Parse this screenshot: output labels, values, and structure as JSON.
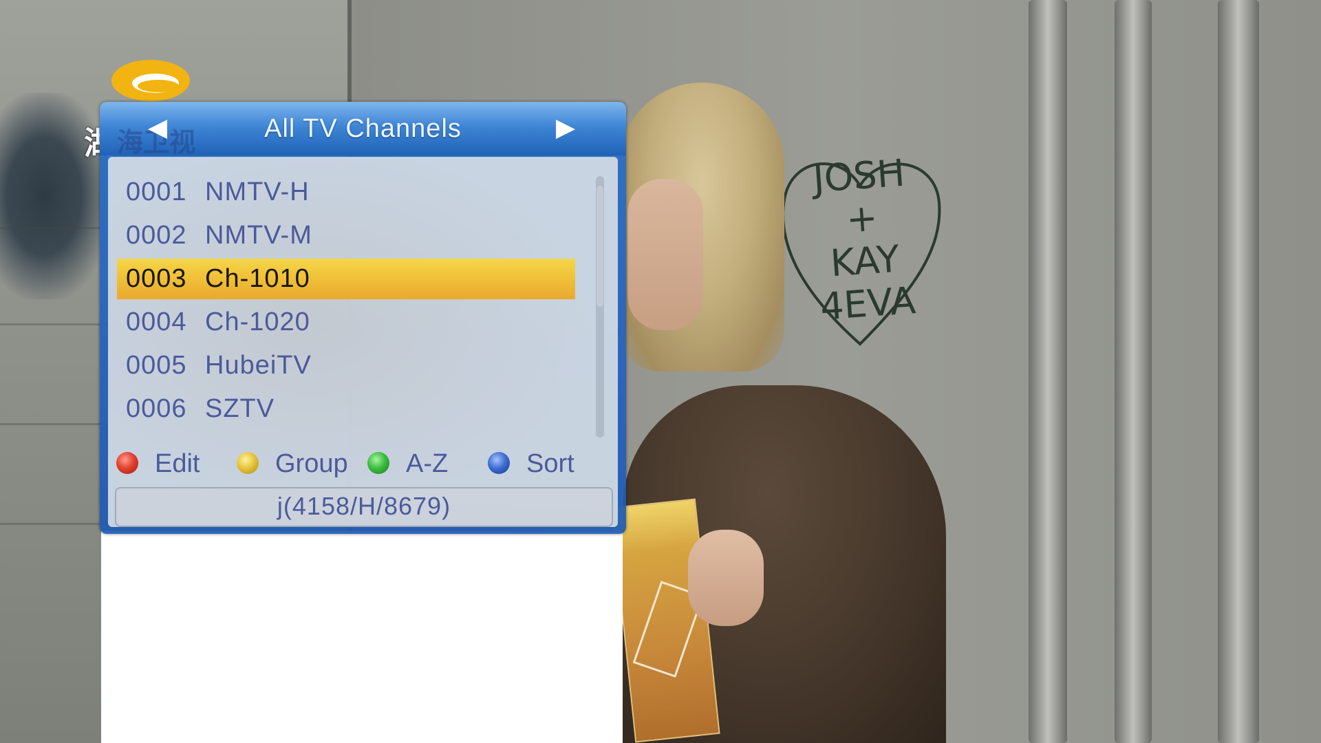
{
  "osd": {
    "title": "All TV Channels",
    "title_ghost": "海卫视",
    "channels": [
      {
        "number": "0001",
        "name": "NMTV-H"
      },
      {
        "number": "0002",
        "name": "NMTV-M"
      },
      {
        "number": "0003",
        "name": "Ch-1010"
      },
      {
        "number": "0004",
        "name": "Ch-1020"
      },
      {
        "number": "0005",
        "name": "HubeiTV"
      },
      {
        "number": "0006",
        "name": "SZTV"
      }
    ],
    "selected_index": 2,
    "scroll_position_fraction": 0.07,
    "keys": [
      {
        "color": "red",
        "label": "Edit"
      },
      {
        "color": "yellow",
        "label": "Group"
      },
      {
        "color": "green",
        "label": "A-Z"
      },
      {
        "color": "blue",
        "label": "Sort"
      }
    ],
    "transponder_info": "j(4158/H/8679)"
  },
  "channel_logo": {
    "glyph": "湖",
    "colors": {
      "logo_fill": "#f2b411",
      "logo_inner": "#ffffff"
    }
  },
  "background": {
    "graffiti_text": [
      "JOSH",
      "+",
      "KAY",
      "4EVA"
    ]
  },
  "colors": {
    "osd_blue": "#2a6fc8",
    "highlight_yellow": "#f0c43a",
    "text_blue": "#4b5a9b"
  }
}
